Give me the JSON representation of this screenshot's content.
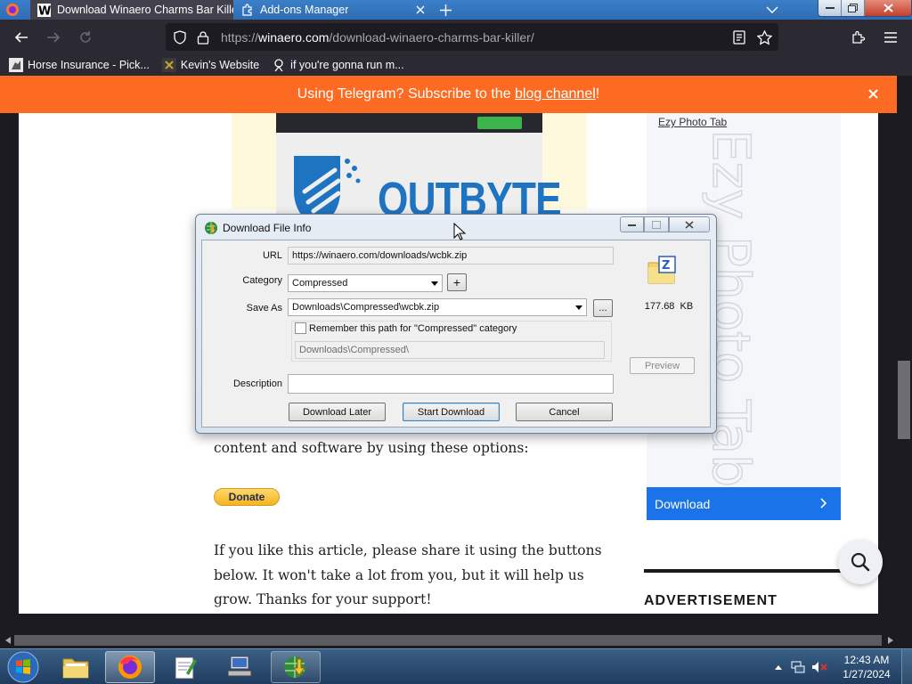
{
  "browser": {
    "tabs": [
      {
        "title": "Download Winaero Charms Bar Kille",
        "active": true,
        "favicon": "winaero-w-icon"
      },
      {
        "title": "Add-ons Manager",
        "active": false,
        "favicon": "puzzle-icon"
      }
    ],
    "url_prefix": "https://",
    "url_host": "winaero.com",
    "url_path": "/download-winaero-charms-bar-killer/",
    "bookmarks": [
      {
        "label": "Horse Insurance - Pick...",
        "icon": "horse-icon"
      },
      {
        "label": "Kevin's Website",
        "icon": "site-icon"
      },
      {
        "label": "if you're gonna run m...",
        "icon": "bookmark-icon"
      }
    ]
  },
  "page": {
    "banner_prefix": "Using Telegram? Subscribe to the ",
    "banner_link": "blog channel",
    "banner_suffix": "!",
    "ad_brand": "OUTBYTE",
    "sidebar_link": "Ezy Photo Tab",
    "sidebar_watermark": "Ezy Photo Tab",
    "download_button": "Download",
    "advertisement_label": "ADVERTISEMENT",
    "para1": "content and software by using these options:",
    "donate_label": "Donate",
    "para2": "If you like this article, please share it using the buttons below. It won't take a lot from you, but it will help us grow. Thanks for your support!"
  },
  "dialog": {
    "title": "Download File Info",
    "url_label": "URL",
    "url_value": "https://winaero.com/downloads/wcbk.zip",
    "category_label": "Category",
    "category_value": "Compressed",
    "add_category": "+",
    "saveas_label": "Save As",
    "saveas_value": "Downloads\\Compressed\\wcbk.zip",
    "browse_label": "...",
    "remember_label": "Remember this path for \"Compressed\" category",
    "remember_checked": false,
    "default_path": "Downloads\\Compressed\\",
    "file_size": "177.68  KB",
    "preview_label": "Preview",
    "description_label": "Description",
    "description_value": "",
    "download_later": "Download Later",
    "start_download": "Start Download",
    "cancel": "Cancel"
  },
  "taskbar": {
    "time": "12:43 AM",
    "date": "1/27/2024",
    "apps": [
      "explorer-icon",
      "firefox-icon",
      "notepad-icon",
      "network-computer-icon",
      "idm-icon"
    ]
  },
  "colors": {
    "banner": "#fd6a21",
    "accent": "#1a73e8",
    "outbyte_blue": "#1f74c2"
  }
}
